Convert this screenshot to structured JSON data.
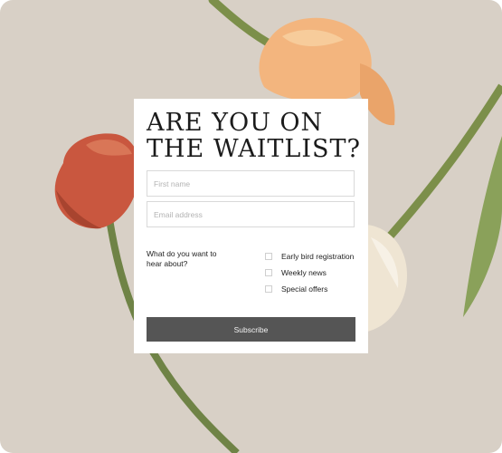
{
  "form": {
    "title_line1": "ARE YOU ON",
    "title_line2": "THE WAITLIST?",
    "first_name_placeholder": "First name",
    "email_placeholder": "Email address",
    "interests_question": "What do you want to hear about?",
    "options": [
      {
        "label": "Early bird registration",
        "checked": false
      },
      {
        "label": "Weekly news",
        "checked": false
      },
      {
        "label": "Special offers",
        "checked": false
      }
    ],
    "subscribe_label": "Subscribe"
  },
  "colors": {
    "background": "#d8d0c6",
    "button": "#555555",
    "tulip_peach": "#f2b27a",
    "tulip_red": "#c9573f",
    "tulip_cream": "#efe6d6",
    "stem": "#7c8f4a"
  }
}
